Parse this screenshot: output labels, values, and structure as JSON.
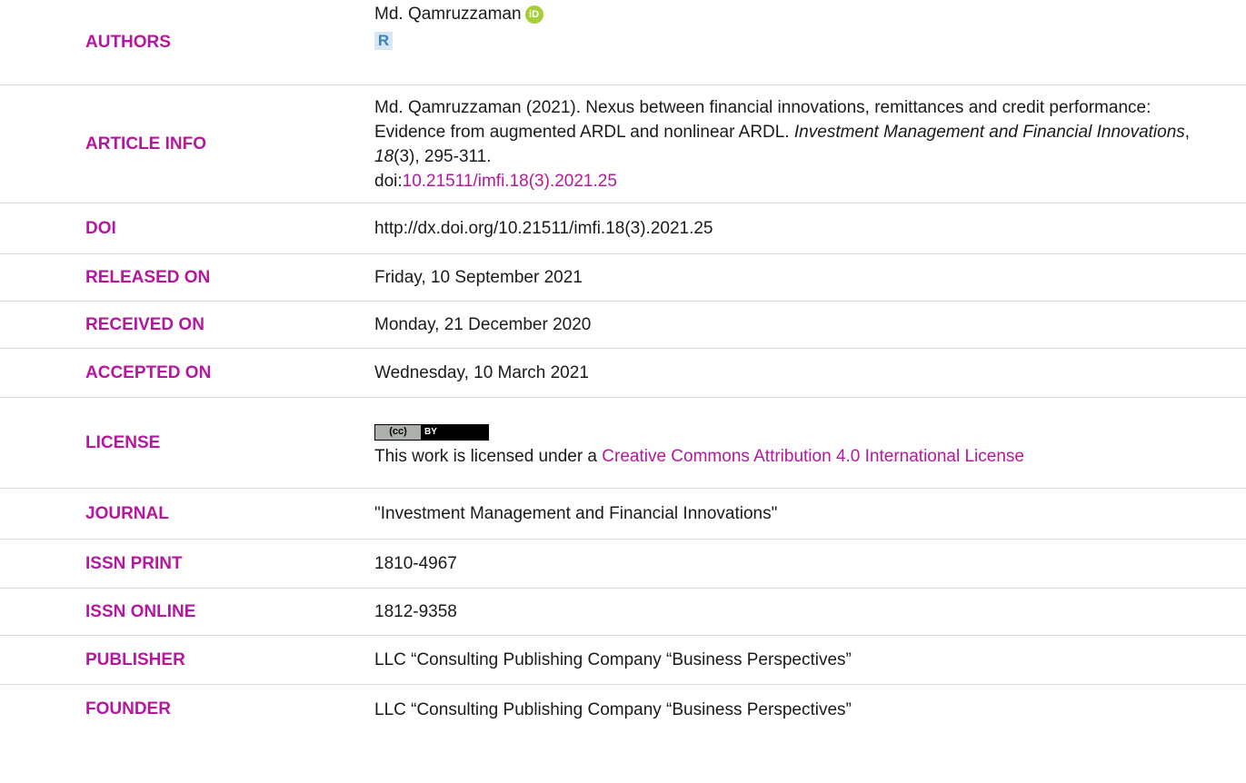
{
  "rows": {
    "authors": {
      "label": "AUTHORS",
      "name": "Md. Qamruzzaman",
      "orcid_icon": "orcid-icon",
      "orcid_glyph": "iD",
      "researchgate_icon": "researchgate-icon",
      "researchgate_glyph": "R"
    },
    "article_info": {
      "label": "ARTICLE INFO",
      "citation_prefix": "Md. Qamruzzaman (2021). Nexus between financial innovations, remittances and credit performance: Evidence from augmented ARDL and nonlinear ARDL. ",
      "journal_italic": "Investment Management and Financial Innovations",
      "comma": ", ",
      "volume_italic": "18",
      "issue_pages": "(3), 295-311.",
      "doi_prefix": "doi:",
      "doi_link": "10.21511/imfi.18(3).2021.25"
    },
    "doi": {
      "label": "DOI",
      "value": "http://dx.doi.org/10.21511/imfi.18(3).2021.25"
    },
    "released_on": {
      "label": "RELEASED ON",
      "value": "Friday, 10 September 2021"
    },
    "received_on": {
      "label": "RECEIVED ON",
      "value": "Monday, 21 December 2020"
    },
    "accepted_on": {
      "label": "ACCEPTED ON",
      "value": "Wednesday, 10 March 2021"
    },
    "license": {
      "label": "LICENSE",
      "badge_left": "(cc)",
      "badge_right": "BY",
      "text_prefix": "This work is licensed under a ",
      "link": "Creative Commons Attribution 4.0 International License"
    },
    "journal": {
      "label": "JOURNAL",
      "value": "\"Investment Management and Financial Innovations\""
    },
    "issn_print": {
      "label": "ISSN PRINT",
      "value": "1810-4967"
    },
    "issn_online": {
      "label": "ISSN ONLINE",
      "value": "1812-9358"
    },
    "publisher": {
      "label": "PUBLISHER",
      "value": "LLC “Consulting Publishing Company “Business Perspectives”"
    },
    "founder": {
      "label": "FOUNDER",
      "value": "LLC “Consulting Publishing Company “Business Perspectives”"
    }
  },
  "colors": {
    "label": "#b5179e",
    "link": "#b5179e",
    "orcid": "#a6ce39",
    "researchgate": "#3b7fc4"
  }
}
